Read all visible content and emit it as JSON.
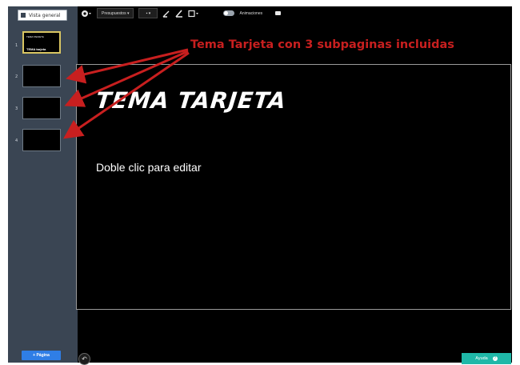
{
  "sidebar": {
    "overview_label": "Vista general",
    "slides": [
      {
        "number": "1",
        "thumb_small": "TEMA TARJETA",
        "thumb_title": "TEMA tarjeta"
      },
      {
        "number": "2"
      },
      {
        "number": "3"
      },
      {
        "number": "4"
      }
    ],
    "add_page_label": "+ Página"
  },
  "toolbar": {
    "layouts_label": "Presupuestos ▾",
    "color_label": "▪ ▾",
    "animations_label": "Animaciones"
  },
  "canvas": {
    "title": "TEMA TARJETA",
    "body": "Doble clic para editar"
  },
  "annotation": {
    "text": "Tema Tarjeta con 3 subpaginas incluidas",
    "color": "#c81f1f"
  },
  "footer": {
    "help_label": "Ayuda",
    "help_icon": "?"
  },
  "colors": {
    "sidebar": "#3a4553",
    "accent": "#2f7ee6",
    "help": "#1fb8a8",
    "active_thumb_border": "#d9c562"
  }
}
